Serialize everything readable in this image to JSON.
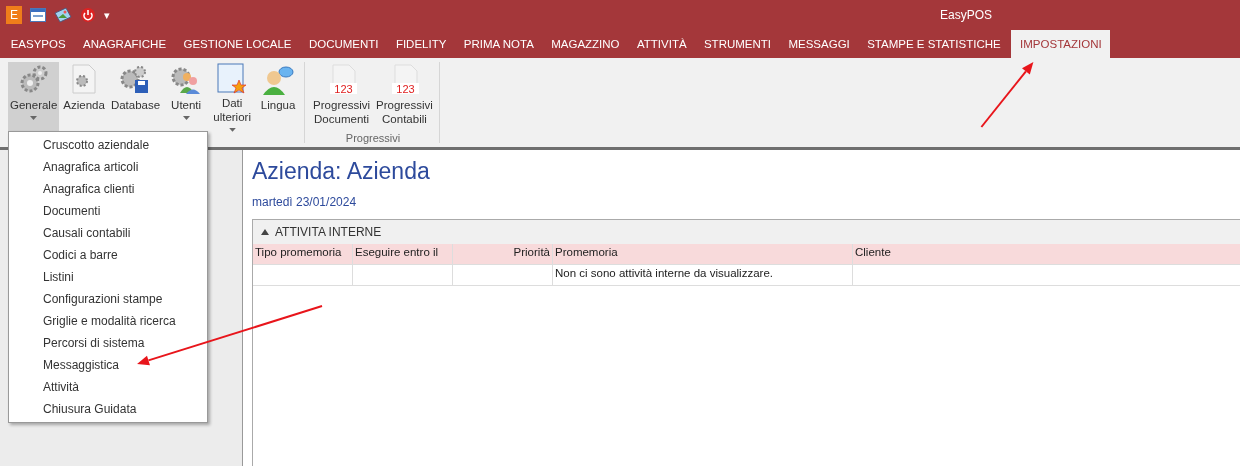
{
  "window": {
    "title": "EasyPOS",
    "quick_access": [
      {
        "kind": "logo",
        "label": "E"
      },
      {
        "kind": "window"
      },
      {
        "kind": "image"
      },
      {
        "kind": "power"
      },
      {
        "kind": "caret",
        "label": "▾"
      }
    ]
  },
  "tabs": [
    {
      "label": "EASYPOS",
      "selected": false
    },
    {
      "label": "ANAGRAFICHE",
      "selected": false
    },
    {
      "label": "GESTIONE LOCALE",
      "selected": false
    },
    {
      "label": "DOCUMENTI",
      "selected": false
    },
    {
      "label": "FIDELITY",
      "selected": false
    },
    {
      "label": "PRIMA NOTA",
      "selected": false
    },
    {
      "label": "MAGAZZINO",
      "selected": false
    },
    {
      "label": "ATTIVITÀ",
      "selected": false
    },
    {
      "label": "STRUMENTI",
      "selected": false
    },
    {
      "label": "MESSAGGI",
      "selected": false
    },
    {
      "label": "STAMPE E STATISTICHE",
      "selected": false
    },
    {
      "label": "IMPOSTAZIONI",
      "selected": true
    }
  ],
  "ribbon": {
    "groups": [
      {
        "buttons": [
          {
            "label": "Generale",
            "selected": true,
            "dropdown": true
          },
          {
            "label": "Azienda",
            "selected": false,
            "dropdown": false
          },
          {
            "label": "Database",
            "selected": false,
            "dropdown": false
          },
          {
            "label": "Utenti",
            "selected": false,
            "dropdown": true
          },
          {
            "label": "Dati ulteriori",
            "selected": false,
            "dropdown": true
          },
          {
            "label": "Lingua",
            "selected": false,
            "dropdown": false
          }
        ]
      },
      {
        "label": "Progressivi",
        "buttons": [
          {
            "label": "Progressivi Documenti",
            "icon_text": "123",
            "selected": false,
            "dropdown": false
          },
          {
            "label": "Progressivi Contabili",
            "icon_text": "123",
            "selected": false,
            "dropdown": false
          }
        ]
      }
    ]
  },
  "menu": [
    {
      "label": "Cruscotto aziendale",
      "pointed": false
    },
    {
      "label": "Anagrafica articoli",
      "pointed": false
    },
    {
      "label": "Anagrafica clienti",
      "pointed": false
    },
    {
      "label": "Documenti",
      "pointed": false
    },
    {
      "label": "Causali contabili",
      "pointed": false
    },
    {
      "label": "Codici a barre",
      "pointed": false
    },
    {
      "label": "Listini",
      "pointed": false
    },
    {
      "label": "Configurazioni stampe",
      "pointed": false
    },
    {
      "label": "Griglie e modalità ricerca",
      "pointed": false
    },
    {
      "label": "Percorsi di sistema",
      "pointed": false
    },
    {
      "label": "Messaggistica",
      "pointed": true
    },
    {
      "label": "Attività",
      "pointed": false
    },
    {
      "label": "Chiusura Guidata",
      "pointed": false
    }
  ],
  "page": {
    "title": "Azienda: Azienda",
    "date": "martedì 23/01/2024",
    "section": {
      "label": "ATTIVITA INTERNE",
      "expanded": true,
      "columns": [
        "Tipo promemoria",
        "Eseguire entro il",
        "Priorità",
        "Promemoria",
        "Cliente"
      ],
      "rows": [
        [
          "",
          "",
          "",
          "Non ci sono attività interne da visualizzare.",
          ""
        ]
      ]
    }
  }
}
